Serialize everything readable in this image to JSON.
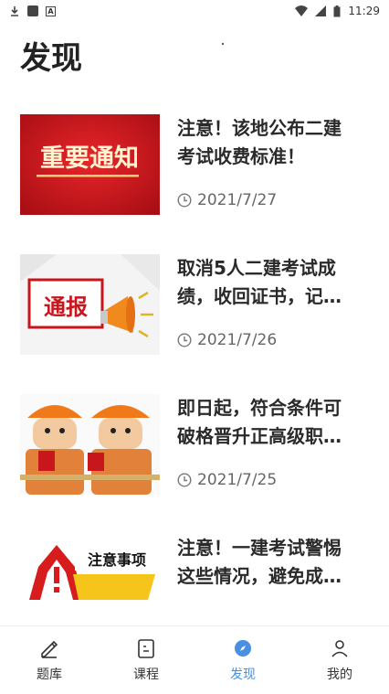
{
  "status_bar": {
    "time": "11:29"
  },
  "page": {
    "title": "发现"
  },
  "articles": [
    {
      "title_line1": "注意！该地公布二建",
      "title_line2": "考试收费标准！",
      "date": "2021/7/27",
      "thumb_text": "重要通知",
      "thumb_icon": "important-notice-banner"
    },
    {
      "title_line1": "取消5人二建考试成",
      "title_line2": "绩，收回证书，记…",
      "date": "2021/7/26",
      "thumb_text": "通报",
      "thumb_icon": "megaphone-icon"
    },
    {
      "title_line1": "即日起，符合条件可",
      "title_line2": "破格晋升正高级职…",
      "date": "2021/7/25",
      "thumb_icon": "construction-workers"
    },
    {
      "title_line1": "注意！一建考试警惕",
      "title_line2": "这些情况，避免成…",
      "date": "",
      "thumb_text": "注意事项",
      "thumb_icon": "warning-icon"
    }
  ],
  "bottom_nav": [
    {
      "label": "题库",
      "icon": "pencil-icon"
    },
    {
      "label": "课程",
      "icon": "document-icon"
    },
    {
      "label": "发现",
      "icon": "discover-icon",
      "active": true
    },
    {
      "label": "我的",
      "icon": "user-icon"
    }
  ],
  "colors": {
    "accent": "#4a90e2",
    "notice_red": "#c8161d"
  }
}
